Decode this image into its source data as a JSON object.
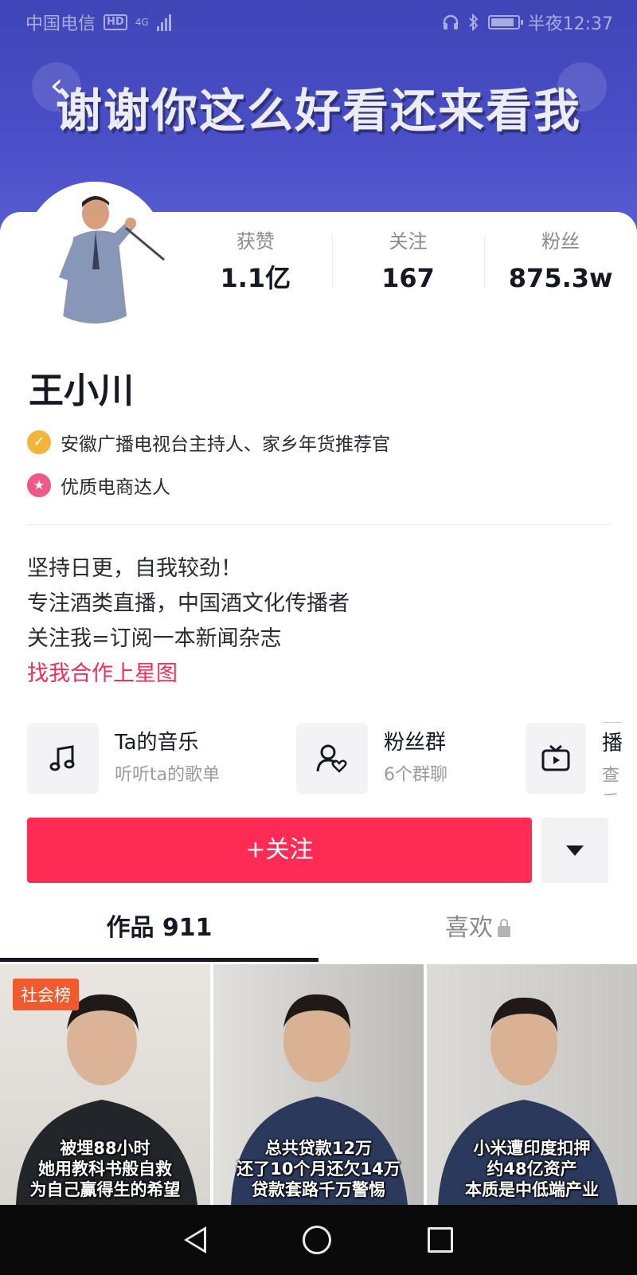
{
  "status_bar": {
    "carrier": "中国电信",
    "hd": "HD",
    "network": "4G",
    "time": "半夜12:37"
  },
  "banner": {
    "slogan": "谢谢你这么好看还来看我",
    "back_icon": "chevron-left-icon"
  },
  "profile": {
    "stats": [
      {
        "label": "获赞",
        "value": "1.1亿"
      },
      {
        "label": "关注",
        "value": "167"
      },
      {
        "label": "粉丝",
        "value": "875.3w"
      }
    ],
    "nickname": "王小川",
    "verification": "安徽广播电视台主持人、家乡年货推荐官",
    "badge": "优质电商达人",
    "bio": [
      "坚持日更，自我较劲！",
      "专注酒类直播，中国酒文化传播者",
      "关注我=订阅一本新闻杂志"
    ],
    "bio_link": "找我合作上星图"
  },
  "function_cards": [
    {
      "title": "Ta的音乐",
      "subtitle": "听听ta的歌单",
      "icon": "music-note-icon"
    },
    {
      "title": "粉丝群",
      "subtitle": "6个群聊",
      "icon": "fan-group-icon"
    },
    {
      "title": "直播",
      "subtitle": "查看",
      "icon": "tv-live-icon"
    }
  ],
  "actions": {
    "follow": "+关注",
    "dropdown_icon": "caret-down-icon"
  },
  "tabs": [
    {
      "label": "作品 911",
      "active": true
    },
    {
      "label": "喜欢",
      "active": false,
      "icon": "lock-icon"
    }
  ],
  "videos": [
    {
      "tag": "社会榜",
      "caption": [
        "被埋88小时",
        "她用教科书般自救",
        "为自己赢得生的希望"
      ]
    },
    {
      "tag": "",
      "caption": [
        "总共贷款12万",
        "还了10个月还欠14万",
        "贷款套路千万警惕"
      ]
    },
    {
      "tag": "",
      "caption": [
        "小米遭印度扣押",
        "约48亿资产",
        "本质是中低端产业"
      ]
    }
  ],
  "colors": {
    "banner": "#4b4fc8",
    "follow_button": "#fe2c55",
    "link": "#f0305a",
    "verified_badge": "#f2b53b",
    "merchant_badge": "#f0588a"
  }
}
